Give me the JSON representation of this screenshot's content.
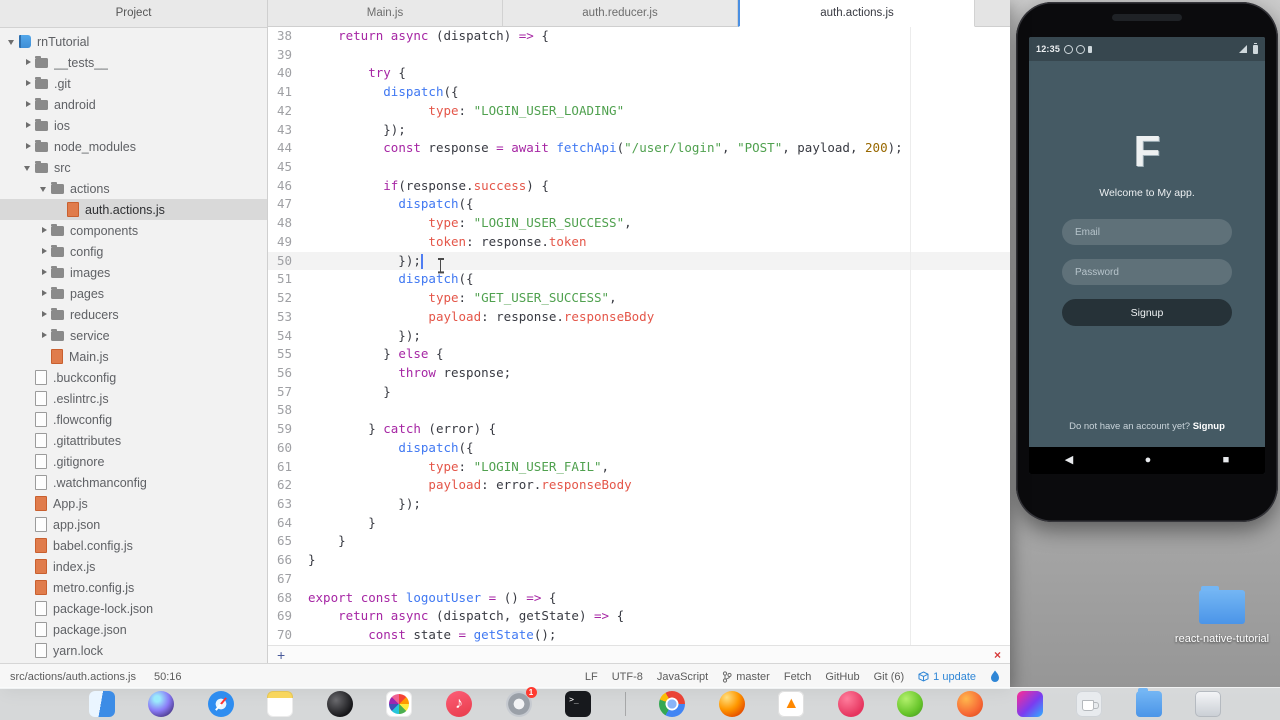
{
  "theme": {
    "accent_blue": "#4078f2",
    "keyword_purple": "#a626a4",
    "string_green": "#50a14f",
    "property_red": "#e45649",
    "number_orange": "#986801",
    "selection_gray": "#d9d9d9",
    "phone_background": "#455a64",
    "phone_button_dark": "#263238",
    "badge_red": "#ff3b30",
    "status_accent": "#2f86d6"
  },
  "window": {
    "sidebar": {
      "header": "Project",
      "tree": [
        {
          "label": "rnTutorial",
          "level": 0,
          "kind": "root",
          "expanded": true
        },
        {
          "label": "__tests__",
          "level": 1,
          "kind": "folder",
          "expanded": false
        },
        {
          "label": ".git",
          "level": 1,
          "kind": "folder",
          "expanded": false
        },
        {
          "label": "android",
          "level": 1,
          "kind": "folder",
          "expanded": false
        },
        {
          "label": "ios",
          "level": 1,
          "kind": "folder",
          "expanded": false
        },
        {
          "label": "node_modules",
          "level": 1,
          "kind": "folder",
          "expanded": false
        },
        {
          "label": "src",
          "level": 1,
          "kind": "folder",
          "expanded": true
        },
        {
          "label": "actions",
          "level": 2,
          "kind": "folder",
          "expanded": true
        },
        {
          "label": "auth.actions.js",
          "level": 3,
          "kind": "file",
          "ext": "js",
          "selected": true
        },
        {
          "label": "components",
          "level": 2,
          "kind": "folder",
          "expanded": false
        },
        {
          "label": "config",
          "level": 2,
          "kind": "folder",
          "expanded": false
        },
        {
          "label": "images",
          "level": 2,
          "kind": "folder",
          "expanded": false
        },
        {
          "label": "pages",
          "level": 2,
          "kind": "folder",
          "expanded": false
        },
        {
          "label": "reducers",
          "level": 2,
          "kind": "folder",
          "expanded": false
        },
        {
          "label": "service",
          "level": 2,
          "kind": "folder",
          "expanded": false
        },
        {
          "label": "Main.js",
          "level": 2,
          "kind": "file",
          "ext": "js"
        },
        {
          "label": ".buckconfig",
          "level": 1,
          "kind": "file"
        },
        {
          "label": ".eslintrc.js",
          "level": 1,
          "kind": "file"
        },
        {
          "label": ".flowconfig",
          "level": 1,
          "kind": "file"
        },
        {
          "label": ".gitattributes",
          "level": 1,
          "kind": "file"
        },
        {
          "label": ".gitignore",
          "level": 1,
          "kind": "file"
        },
        {
          "label": ".watchmanconfig",
          "level": 1,
          "kind": "file"
        },
        {
          "label": "App.js",
          "level": 1,
          "kind": "file",
          "ext": "js"
        },
        {
          "label": "app.json",
          "level": 1,
          "kind": "file"
        },
        {
          "label": "babel.config.js",
          "level": 1,
          "kind": "file",
          "ext": "js"
        },
        {
          "label": "index.js",
          "level": 1,
          "kind": "file",
          "ext": "js"
        },
        {
          "label": "metro.config.js",
          "level": 1,
          "kind": "file",
          "ext": "js"
        },
        {
          "label": "package-lock.json",
          "level": 1,
          "kind": "file"
        },
        {
          "label": "package.json",
          "level": 1,
          "kind": "file"
        },
        {
          "label": "yarn.lock",
          "level": 1,
          "kind": "file"
        }
      ]
    },
    "tabs": [
      {
        "label": "Main.js",
        "active": false
      },
      {
        "label": "auth.reducer.js",
        "active": false
      },
      {
        "label": "auth.actions.js",
        "active": true
      }
    ],
    "editor": {
      "cursor": {
        "line": 50,
        "col": 15
      },
      "lines": [
        {
          "n": 38,
          "t": [
            [
              "p",
              "    "
            ],
            [
              "k",
              "return"
            ],
            [
              "p",
              " "
            ],
            [
              "k",
              "async"
            ],
            [
              "p",
              " (dispatch) "
            ],
            [
              "k",
              "=>"
            ],
            [
              "p",
              " {"
            ]
          ]
        },
        {
          "n": 39,
          "t": []
        },
        {
          "n": 40,
          "t": [
            [
              "p",
              "        "
            ],
            [
              "k",
              "try"
            ],
            [
              "p",
              " {"
            ]
          ]
        },
        {
          "n": 41,
          "t": [
            [
              "p",
              "          "
            ],
            [
              "f",
              "dispatch"
            ],
            [
              "p",
              "({"
            ]
          ]
        },
        {
          "n": 42,
          "t": [
            [
              "p",
              "                "
            ],
            [
              "y",
              "type"
            ],
            [
              "p",
              ": "
            ],
            [
              "s",
              "\"LOGIN_USER_LOADING\""
            ]
          ]
        },
        {
          "n": 43,
          "t": [
            [
              "p",
              "          });"
            ]
          ]
        },
        {
          "n": 44,
          "t": [
            [
              "p",
              "          "
            ],
            [
              "k",
              "const"
            ],
            [
              "p",
              " response "
            ],
            [
              "k",
              "="
            ],
            [
              "p",
              " "
            ],
            [
              "k",
              "await"
            ],
            [
              "p",
              " "
            ],
            [
              "f",
              "fetchApi"
            ],
            [
              "p",
              "("
            ],
            [
              "s",
              "\"/user/login\""
            ],
            [
              "p",
              ", "
            ],
            [
              "s",
              "\"POST\""
            ],
            [
              "p",
              ", payload, "
            ],
            [
              "n",
              "200"
            ],
            [
              "p",
              ");"
            ]
          ]
        },
        {
          "n": 45,
          "t": []
        },
        {
          "n": 46,
          "t": [
            [
              "p",
              "          "
            ],
            [
              "k",
              "if"
            ],
            [
              "p",
              "(response."
            ],
            [
              "y",
              "success"
            ],
            [
              "p",
              ") {"
            ]
          ]
        },
        {
          "n": 47,
          "t": [
            [
              "p",
              "            "
            ],
            [
              "f",
              "dispatch"
            ],
            [
              "p",
              "({"
            ]
          ]
        },
        {
          "n": 48,
          "t": [
            [
              "p",
              "                "
            ],
            [
              "y",
              "type"
            ],
            [
              "p",
              ": "
            ],
            [
              "s",
              "\"LOGIN_USER_SUCCESS\""
            ],
            [
              "p",
              ","
            ]
          ]
        },
        {
          "n": 49,
          "t": [
            [
              "p",
              "                "
            ],
            [
              "y",
              "token"
            ],
            [
              "p",
              ": response."
            ],
            [
              "y",
              "token"
            ]
          ]
        },
        {
          "n": 50,
          "t": [
            [
              "p",
              "            });"
            ]
          ]
        },
        {
          "n": 51,
          "t": [
            [
              "p",
              "            "
            ],
            [
              "f",
              "dispatch"
            ],
            [
              "p",
              "({"
            ]
          ]
        },
        {
          "n": 52,
          "t": [
            [
              "p",
              "                "
            ],
            [
              "y",
              "type"
            ],
            [
              "p",
              ": "
            ],
            [
              "s",
              "\"GET_USER_SUCCESS\""
            ],
            [
              "p",
              ","
            ]
          ]
        },
        {
          "n": 53,
          "t": [
            [
              "p",
              "                "
            ],
            [
              "y",
              "payload"
            ],
            [
              "p",
              ": response."
            ],
            [
              "y",
              "responseBody"
            ]
          ]
        },
        {
          "n": 54,
          "t": [
            [
              "p",
              "            });"
            ]
          ]
        },
        {
          "n": 55,
          "t": [
            [
              "p",
              "          } "
            ],
            [
              "k",
              "else"
            ],
            [
              "p",
              " {"
            ]
          ]
        },
        {
          "n": 56,
          "t": [
            [
              "p",
              "            "
            ],
            [
              "k",
              "throw"
            ],
            [
              "p",
              " response;"
            ]
          ]
        },
        {
          "n": 57,
          "t": [
            [
              "p",
              "          }"
            ]
          ]
        },
        {
          "n": 58,
          "t": []
        },
        {
          "n": 59,
          "t": [
            [
              "p",
              "        } "
            ],
            [
              "k",
              "catch"
            ],
            [
              "p",
              " (error) {"
            ]
          ]
        },
        {
          "n": 60,
          "t": [
            [
              "p",
              "            "
            ],
            [
              "f",
              "dispatch"
            ],
            [
              "p",
              "({"
            ]
          ]
        },
        {
          "n": 61,
          "t": [
            [
              "p",
              "                "
            ],
            [
              "y",
              "type"
            ],
            [
              "p",
              ": "
            ],
            [
              "s",
              "\"LOGIN_USER_FAIL\""
            ],
            [
              "p",
              ","
            ]
          ]
        },
        {
          "n": 62,
          "t": [
            [
              "p",
              "                "
            ],
            [
              "y",
              "payload"
            ],
            [
              "p",
              ": error."
            ],
            [
              "y",
              "responseBody"
            ]
          ]
        },
        {
          "n": 63,
          "t": [
            [
              "p",
              "            });"
            ]
          ]
        },
        {
          "n": 64,
          "t": [
            [
              "p",
              "        }"
            ]
          ]
        },
        {
          "n": 65,
          "t": [
            [
              "p",
              "    }"
            ]
          ]
        },
        {
          "n": 66,
          "t": [
            [
              "p",
              "}"
            ]
          ]
        },
        {
          "n": 67,
          "t": []
        },
        {
          "n": 68,
          "t": [
            [
              "k",
              "export"
            ],
            [
              "p",
              " "
            ],
            [
              "k",
              "const"
            ],
            [
              "p",
              " "
            ],
            [
              "f",
              "logoutUser"
            ],
            [
              "p",
              " "
            ],
            [
              "k",
              "="
            ],
            [
              "p",
              " () "
            ],
            [
              "k",
              "=>"
            ],
            [
              "p",
              " {"
            ]
          ]
        },
        {
          "n": 69,
          "t": [
            [
              "p",
              "    "
            ],
            [
              "k",
              "return"
            ],
            [
              "p",
              " "
            ],
            [
              "k",
              "async"
            ],
            [
              "p",
              " (dispatch, getState) "
            ],
            [
              "k",
              "=>"
            ],
            [
              "p",
              " {"
            ]
          ]
        },
        {
          "n": 70,
          "t": [
            [
              "p",
              "        "
            ],
            [
              "k",
              "const"
            ],
            [
              "p",
              " state "
            ],
            [
              "k",
              "="
            ],
            [
              "p",
              " "
            ],
            [
              "f",
              "getState"
            ],
            [
              "p",
              "();"
            ]
          ]
        }
      ]
    },
    "panel": {
      "add_label": "+",
      "close_label": "×"
    },
    "status": {
      "path": "src/actions/auth.actions.js",
      "cursor": "50:16",
      "right": [
        {
          "name": "line-ending",
          "label": "LF"
        },
        {
          "name": "encoding",
          "label": "UTF-8"
        },
        {
          "name": "grammar",
          "label": "JavaScript"
        },
        {
          "name": "git-branch",
          "label": "master",
          "icon": "branch"
        },
        {
          "name": "fetch",
          "label": "Fetch"
        },
        {
          "name": "github",
          "label": "GitHub"
        },
        {
          "name": "git-changes",
          "label": "Git (6)"
        },
        {
          "name": "package-updates",
          "label": "1 update",
          "icon": "update",
          "accent": true
        },
        {
          "name": "teletype",
          "label": "",
          "icon": "flame",
          "accent": true
        }
      ]
    }
  },
  "phone": {
    "status": {
      "time": "12:35",
      "left_icons": [
        "gear-icon",
        "gear-icon",
        "usb-icon"
      ],
      "right_icons": [
        "signal-icon",
        "battery-icon"
      ]
    },
    "app": {
      "logo": "F",
      "welcome": "Welcome to My app.",
      "email_placeholder": "Email",
      "password_placeholder": "Password",
      "signup_button": "Signup",
      "footer_text": "Do not have an account yet?",
      "footer_link": "Signup"
    },
    "nav": [
      {
        "name": "back",
        "glyph": "◀"
      },
      {
        "name": "home",
        "glyph": "●"
      },
      {
        "name": "recents",
        "glyph": "■"
      }
    ]
  },
  "desktop": {
    "folder_label": "react-native-tutorial"
  },
  "dock": {
    "items": [
      {
        "name": "finder"
      },
      {
        "name": "siri"
      },
      {
        "name": "safari"
      },
      {
        "name": "notes"
      },
      {
        "name": "photo-booth"
      },
      {
        "name": "photos"
      },
      {
        "name": "music",
        "glyph": "♪"
      },
      {
        "name": "system-preferences",
        "badge": "1"
      },
      {
        "name": "terminal",
        "glyph": ">_"
      },
      {
        "divider": true
      },
      {
        "name": "chrome"
      },
      {
        "name": "firefox"
      },
      {
        "name": "vlc",
        "glyph": "▲"
      },
      {
        "name": "genymotion"
      },
      {
        "name": "android-studio"
      },
      {
        "name": "postman"
      },
      {
        "name": "intellij-idea"
      },
      {
        "name": "coffee-cup"
      },
      {
        "name": "downloads-folder"
      },
      {
        "name": "trash"
      }
    ]
  }
}
